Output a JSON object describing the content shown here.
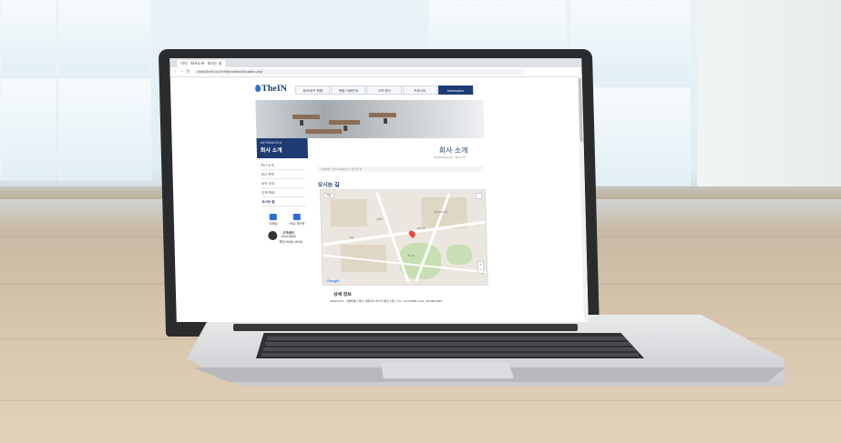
{
  "browser": {
    "tab_title": "더인 · 회사소개 · 오시는 길",
    "url": "www.thein.co.kr/information/location.asp"
  },
  "site": {
    "logo_text": "TheIN",
    "gnb": [
      {
        "label": "장비/공구 렌탈"
      },
      {
        "label": "렌탈 이용안내"
      },
      {
        "label": "고객 센터"
      },
      {
        "label": "커뮤니티"
      },
      {
        "label": "Information",
        "active": true
      }
    ],
    "page_title": "회사 소개",
    "page_subtitle": "INFORMATION · 회사소개",
    "breadcrumb": "HOME > Information > 회사소개",
    "snb": {
      "title_en": "INFORMATION",
      "title_ko": "회사 소개",
      "items": [
        {
          "label": "회사 소개"
        },
        {
          "label": "회사 연혁"
        },
        {
          "label": "조직 안내"
        },
        {
          "label": "인재 채용"
        },
        {
          "label": "오시는 길",
          "active": true
        }
      ]
    },
    "quick": [
      {
        "label": "이메일",
        "icon": "mail-icon"
      },
      {
        "label": "FAQ 게시판",
        "icon": "faq-icon"
      }
    ],
    "customer_center": {
      "title": "고객센터",
      "phone": "1544-0000",
      "hours": "평일 09:00-18:00"
    },
    "section_title": "오시는 길",
    "map": {
      "map_type": "지도",
      "zoom_in": "+",
      "zoom_out": "−",
      "brand": "Google",
      "labels": [
        "서울시청",
        "덕수궁",
        "정동",
        "을지로입구역",
        "시청역"
      ]
    },
    "info_title": "상세 정보",
    "info_text": "ADDRESS : 서울특별시 중구 세종대로 00 더인빌딩 5층 | TEL : 1544-0000 | FAX : 02-000-0000"
  },
  "colors": {
    "brand": "#1f3b74",
    "accent": "#2b6fd1",
    "pin": "#e84a3c"
  }
}
